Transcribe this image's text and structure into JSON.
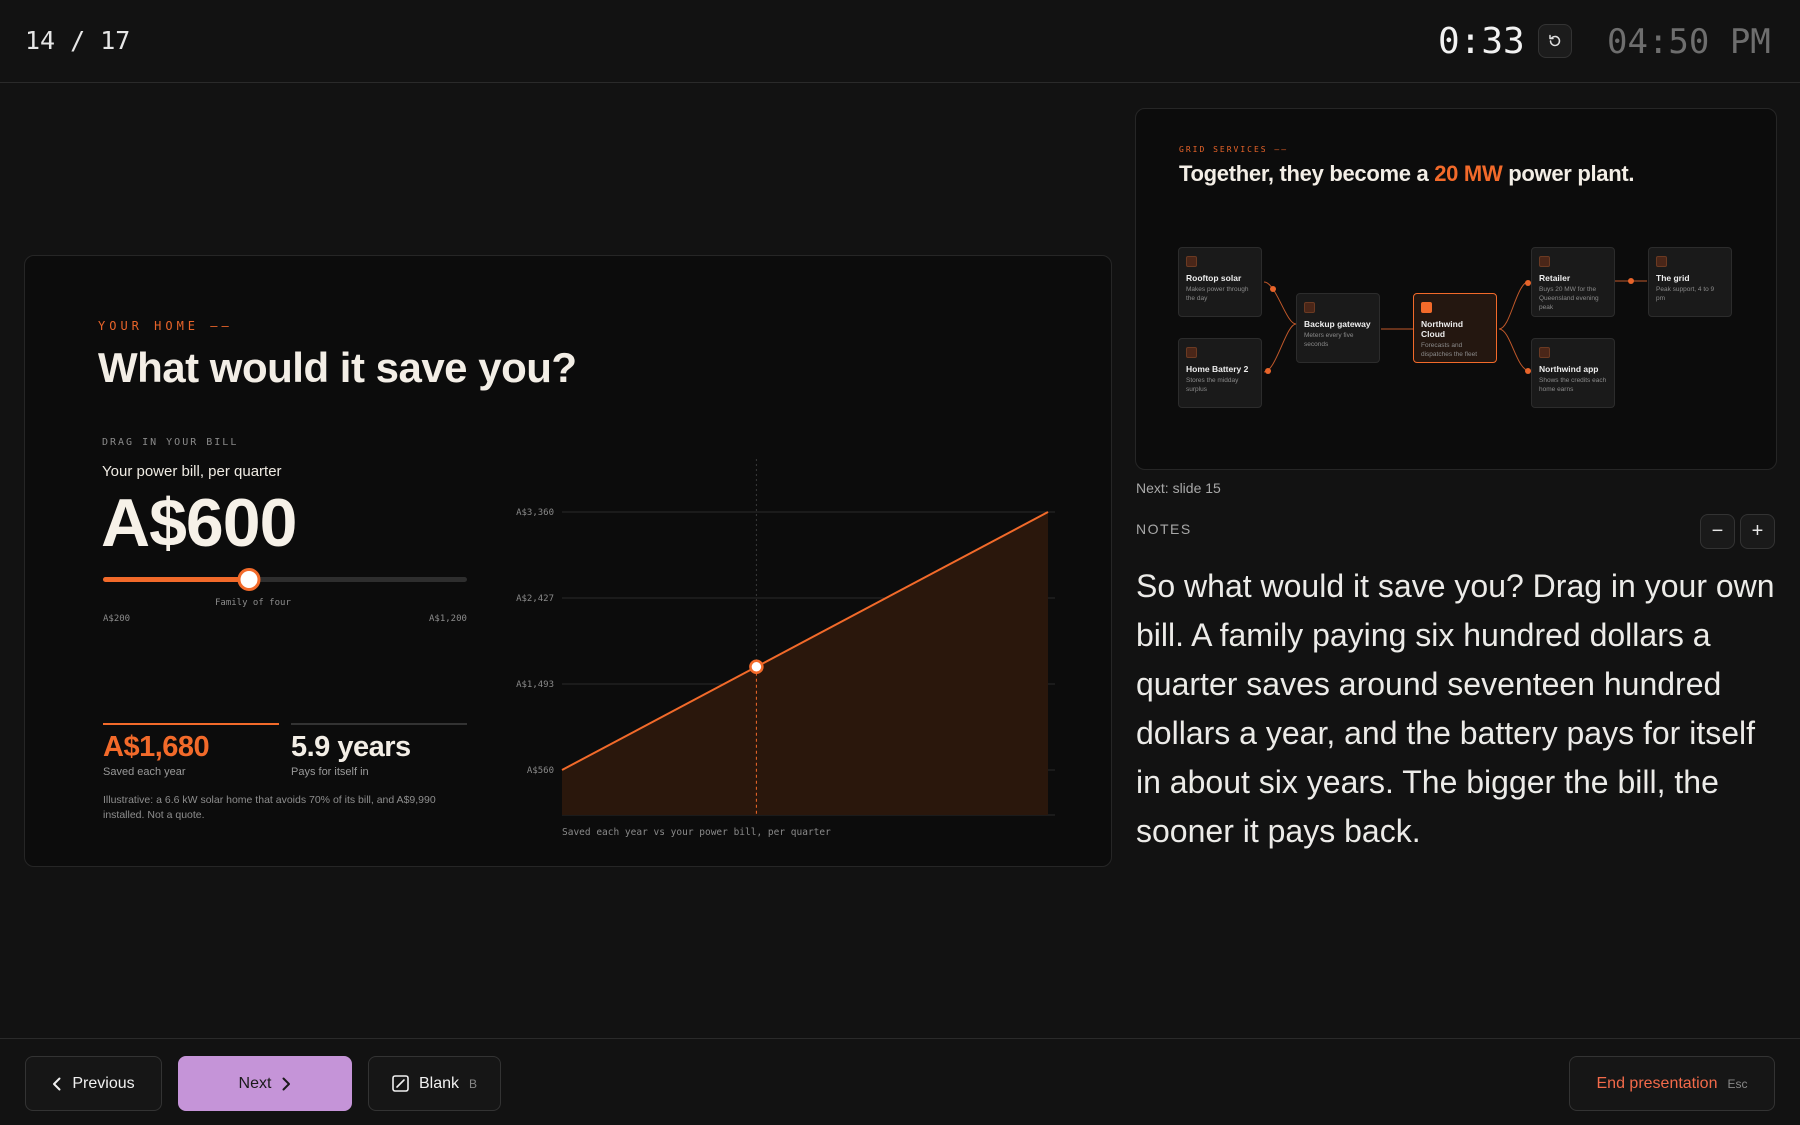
{
  "header": {
    "slide_counter": "14 / 17",
    "timer": "0:33",
    "clock": "04:50 PM"
  },
  "slide": {
    "eyebrow": "YOUR HOME ——",
    "title": "What would it save you?",
    "drag_label": "DRAG IN YOUR BILL",
    "bill_label": "Your power bill, per quarter",
    "bill_value": "A$600",
    "slider": {
      "value": 600,
      "min": 200,
      "max": 1200,
      "caption": "Family of four",
      "min_label": "A$200",
      "max_label": "A$1,200"
    },
    "stats": [
      {
        "value": "A$1,680",
        "label": "Saved each year"
      },
      {
        "value": "5.9 years",
        "label": "Pays for itself in"
      }
    ],
    "disclaimer": "Illustrative: a 6.6 kW solar home that avoids 70% of its bill, and A$9,990 installed. Not a quote."
  },
  "chart_data": {
    "type": "area",
    "x": [
      200,
      1200
    ],
    "y": [
      560,
      3360
    ],
    "marker": {
      "x": 600,
      "y": 1680
    },
    "yticks": [
      "A$560",
      "A$1,493",
      "A$2,427",
      "A$3,360"
    ],
    "ytick_values": [
      560,
      1493,
      2427,
      3360
    ],
    "xlabel": "Saved each year vs your power bill, per quarter",
    "ylim": [
      0,
      3360
    ],
    "xlim": [
      200,
      1200
    ],
    "colors": {
      "line": "#f26a2a",
      "fill": "#2a170c"
    }
  },
  "next_slide": {
    "eyebrow": "GRID SERVICES ——",
    "title_pre": "Together, they become a ",
    "title_highlight": "20 MW",
    "title_post": " power plant.",
    "nodes": [
      {
        "title": "Rooftop solar",
        "desc": "Makes power through the day"
      },
      {
        "title": "Home Battery 2",
        "desc": "Stores the midday surplus"
      },
      {
        "title": "Backup gateway",
        "desc": "Meters every five seconds"
      },
      {
        "title": "Northwind Cloud",
        "desc": "Forecasts and dispatches the fleet"
      },
      {
        "title": "Retailer",
        "desc": "Buys 20 MW for the Queensland evening peak"
      },
      {
        "title": "Northwind app",
        "desc": "Shows the credits each home earns"
      },
      {
        "title": "The grid",
        "desc": "Peak support, 4 to 9 pm"
      }
    ]
  },
  "next_label": "Next: slide 15",
  "notes": {
    "label": "NOTES",
    "text": "So what would it save you? Drag in your own bill. A family paying six hundred dollars a quarter saves around seventeen hundred dollars a year, and the battery pays for itself in about six years. The bigger the bill, the sooner it pays back."
  },
  "footer": {
    "previous": "Previous",
    "next": "Next",
    "blank": "Blank",
    "blank_key": "B",
    "end": "End presentation",
    "end_key": "Esc"
  }
}
